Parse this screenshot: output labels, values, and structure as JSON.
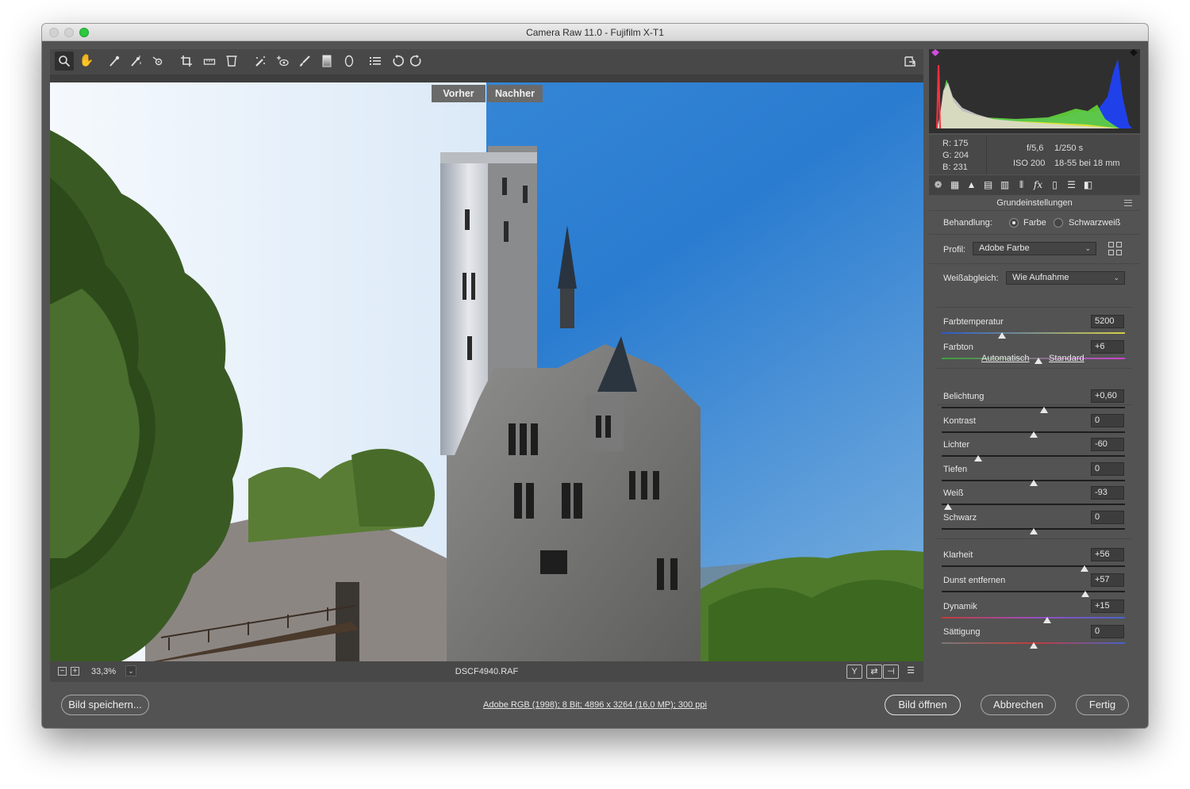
{
  "window": {
    "title": "Camera Raw 11.0 - Fujifilm X-T1"
  },
  "toolbar": {
    "tools": [
      "zoom-icon",
      "hand-icon",
      "white-balance-icon",
      "color-sampler-icon",
      "targeted-adjustment-icon",
      "crop-icon",
      "straighten-icon",
      "transform-icon",
      "spot-removal-icon",
      "red-eye-icon",
      "adjustment-brush-icon",
      "graduated-filter-icon",
      "radial-filter-icon",
      "preferences-icon",
      "rotate-left-icon",
      "rotate-right-icon"
    ],
    "fullscreen_icon": "fullscreen-icon"
  },
  "preview": {
    "before_label": "Vorher",
    "after_label": "Nachher"
  },
  "statusbar": {
    "zoom_out": "−",
    "zoom_in": "+",
    "zoom": "33,3%",
    "zoom_dropdown": "⌄",
    "filename": "DSCF4940.RAF",
    "view_buttons": [
      "Y",
      "⇄",
      "⊣",
      "☰"
    ]
  },
  "readout": {
    "r": "R:  175",
    "g": "G:  204",
    "b": "B:  231",
    "aperture": "f/5,6",
    "shutter": "1/250 s",
    "iso": "ISO 200",
    "lens": "18-55 bei 18 mm"
  },
  "panel": {
    "tabs": [
      "basic-icon",
      "tone-curve-icon",
      "detail-icon",
      "hsl-icon",
      "split-toning-icon",
      "lens-icon",
      "effects-icon",
      "calibration-icon",
      "presets-icon",
      "snapshots-icon"
    ],
    "section_title": "Grundeinstellungen",
    "treatment_label": "Behandlung:",
    "treatment_color": "Farbe",
    "treatment_bw": "Schwarzweiß",
    "profile_label": "Profil:",
    "profile_value": "Adobe Farbe",
    "wb_label": "Weißabgleich:",
    "wb_value": "Wie Aufnahme",
    "auto_link": "Automatisch",
    "default_link": "Standard",
    "sliders": [
      {
        "label": "Farbtemperatur",
        "value": "5200",
        "pos": 0.33
      },
      {
        "label": "Farbton",
        "value": "+6",
        "pos": 0.53
      },
      {
        "label": "Belichtung",
        "value": "+0,60",
        "pos": 0.56
      },
      {
        "label": "Kontrast",
        "value": "0",
        "pos": 0.5
      },
      {
        "label": "Lichter",
        "value": "-60",
        "pos": 0.2
      },
      {
        "label": "Tiefen",
        "value": "0",
        "pos": 0.5
      },
      {
        "label": "Weiß",
        "value": "-93",
        "pos": 0.035
      },
      {
        "label": "Schwarz",
        "value": "0",
        "pos": 0.5
      },
      {
        "label": "Klarheit",
        "value": "+56",
        "pos": 0.78
      },
      {
        "label": "Dunst entfernen",
        "value": "+57",
        "pos": 0.785
      },
      {
        "label": "Dynamik",
        "value": "+15",
        "pos": 0.575
      },
      {
        "label": "Sättigung",
        "value": "0",
        "pos": 0.5
      }
    ]
  },
  "bottom": {
    "save": "Bild speichern...",
    "info": "Adobe RGB (1998); 8 Bit; 4896 x 3264 (16,0 MP); 300 ppi",
    "open": "Bild öffnen",
    "cancel": "Abbrechen",
    "done": "Fertig"
  },
  "colors": {
    "sky_after": "#2a7fd4",
    "sky_before": "#e8f1fa",
    "panel_bg": "#535353"
  }
}
